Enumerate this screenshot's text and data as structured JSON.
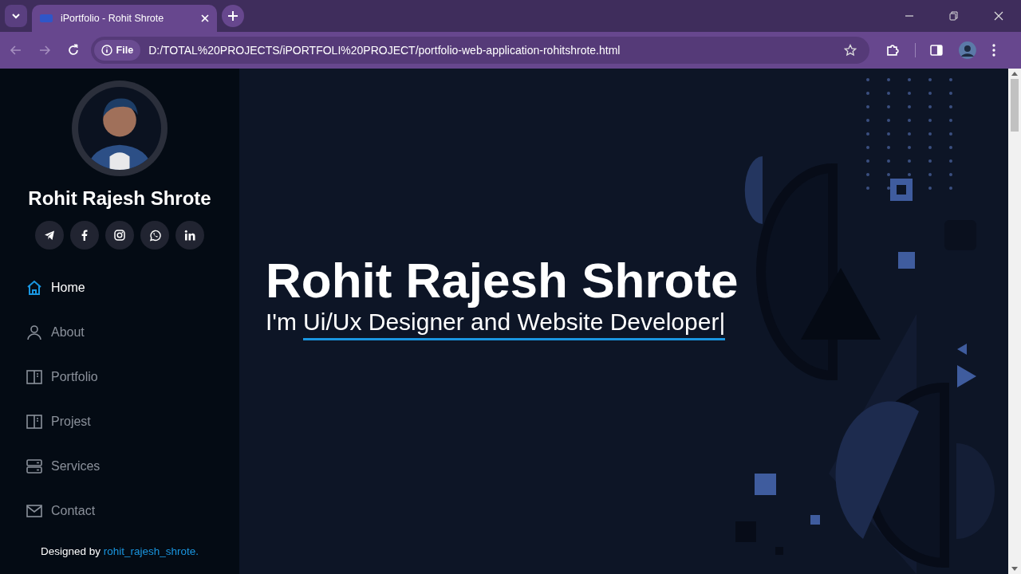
{
  "browser": {
    "tab_title": "iPortfolio - Rohit Shrote",
    "address_chip": "File",
    "url": "D:/TOTAL%20PROJECTS/iPORTFOLI%20PROJECT/portfolio-web-application-rohitshrote.html"
  },
  "sidebar": {
    "name": "Rohit Rajesh Shrote",
    "nav": [
      {
        "label": "Home",
        "selected": true
      },
      {
        "label": "About",
        "selected": false
      },
      {
        "label": "Portfolio",
        "selected": false
      },
      {
        "label": "Projest",
        "selected": false
      },
      {
        "label": "Services",
        "selected": false
      },
      {
        "label": "Contact",
        "selected": false
      }
    ],
    "credit": {
      "text": "Designed by",
      "link": "rohit_rajesh_shrote."
    }
  },
  "hero": {
    "title": "Rohit Rajesh Shrote",
    "prefix": "I'm",
    "typed": "Ui/Ux Designer and Website Developer|"
  }
}
